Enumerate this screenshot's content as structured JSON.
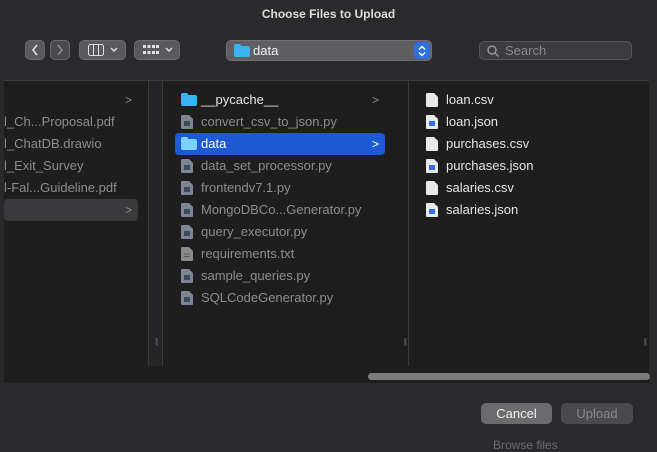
{
  "window": {
    "title": "Choose Files to Upload"
  },
  "toolbar": {
    "path_popup": "data",
    "search_placeholder": "Search"
  },
  "columns": {
    "col1": [
      {
        "label": "",
        "chevron": ">"
      },
      {
        "label": "l_Ch...Proposal.pdf"
      },
      {
        "label": "l_ChatDB.drawio"
      },
      {
        "label": "l_Exit_Survey"
      },
      {
        "label": "l-Fal...Guideline.pdf"
      },
      {
        "label": "",
        "chevron": ">"
      }
    ],
    "col2": [
      {
        "label": "__pycache__",
        "type": "folder",
        "chevron": ">"
      },
      {
        "label": "convert_csv_to_json.py",
        "type": "py"
      },
      {
        "label": "data",
        "type": "folder",
        "chevron": ">",
        "selected": true
      },
      {
        "label": "data_set_processor.py",
        "type": "py"
      },
      {
        "label": "frontendv7.1.py",
        "type": "py"
      },
      {
        "label": "MongoDBCo...Generator.py",
        "type": "py"
      },
      {
        "label": "query_executor.py",
        "type": "py"
      },
      {
        "label": "requirements.txt",
        "type": "txt"
      },
      {
        "label": "sample_queries.py",
        "type": "py"
      },
      {
        "label": "SQLCodeGenerator.py",
        "type": "py"
      }
    ],
    "col3": [
      {
        "label": "loan.csv",
        "type": "csv"
      },
      {
        "label": "loan.json",
        "type": "json"
      },
      {
        "label": "purchases.csv",
        "type": "csv"
      },
      {
        "label": "purchases.json",
        "type": "json"
      },
      {
        "label": "salaries.csv",
        "type": "csv"
      },
      {
        "label": "salaries.json",
        "type": "json"
      }
    ]
  },
  "buttons": {
    "cancel": "Cancel",
    "upload": "Upload"
  },
  "background_text": "Browse files",
  "colors": {
    "accent": "#1f5ad6",
    "folder": "#38b4f0"
  }
}
